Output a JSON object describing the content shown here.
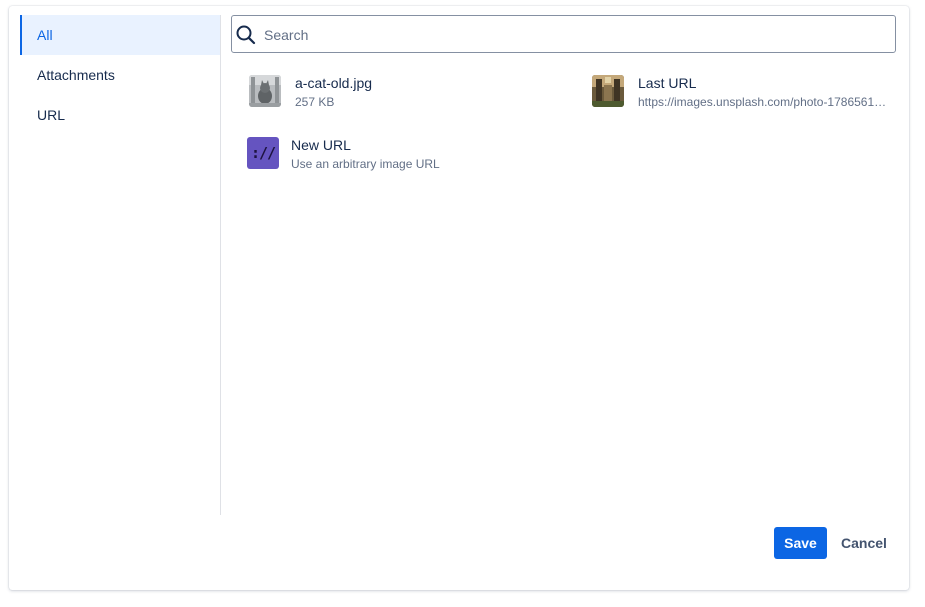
{
  "sidebar": {
    "items": [
      {
        "label": "All",
        "active": true
      },
      {
        "label": "Attachments",
        "active": false
      },
      {
        "label": "URL",
        "active": false
      }
    ]
  },
  "search": {
    "placeholder": "Search",
    "value": "",
    "icon": "search-icon"
  },
  "results": [
    {
      "title": "a-cat-old.jpg",
      "subtitle": "257 KB",
      "icon": "cat-image-thumbnail"
    },
    {
      "title": "Last URL",
      "subtitle": "https://images.unsplash.com/photo-1786561…",
      "icon": "photo-thumbnail"
    },
    {
      "title": "New URL",
      "subtitle": "Use an arbitrary image URL",
      "icon": "link-icon",
      "icon_text": "://",
      "icon_color": "#6554c0"
    }
  ],
  "footer": {
    "save_label": "Save",
    "cancel_label": "Cancel"
  },
  "colors": {
    "accent": "#0c66e4",
    "active_bg": "#e9f2ff",
    "new_url_icon": "#6554c0"
  }
}
